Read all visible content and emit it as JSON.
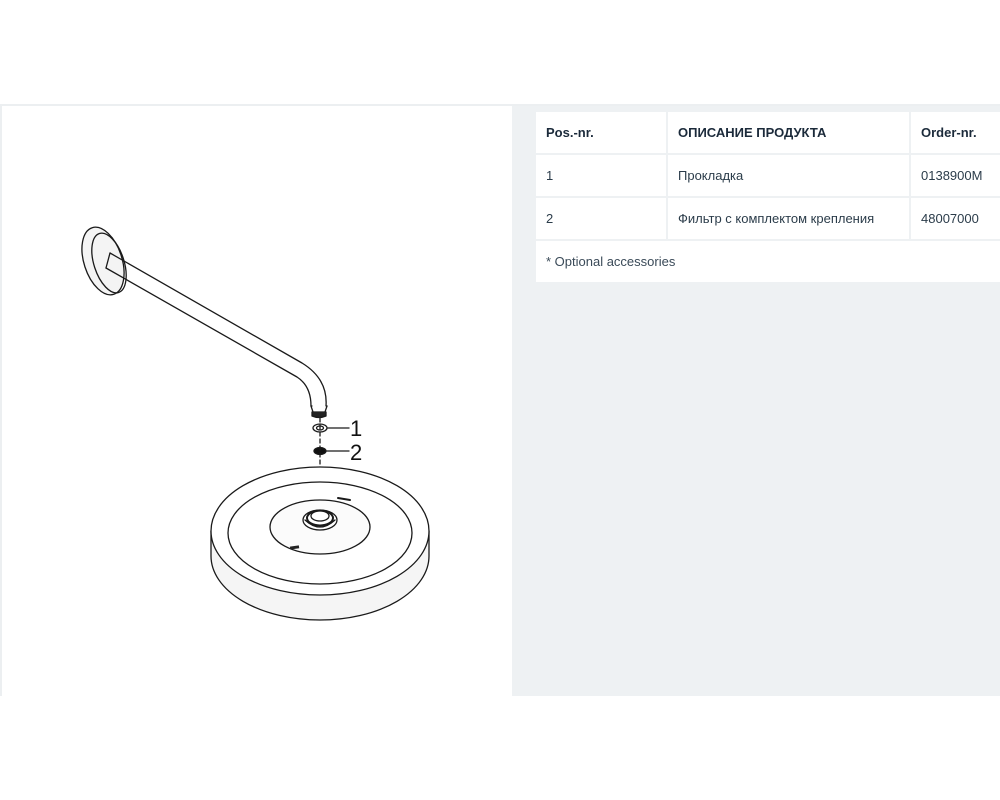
{
  "table": {
    "headers": {
      "pos": "Pos.-nr.",
      "description": "ОПИСАНИЕ ПРОДУКТА",
      "order": "Order-nr."
    },
    "rows": [
      {
        "pos": "1",
        "description": "Прокладка",
        "order": "0138900M"
      },
      {
        "pos": "2",
        "description": "Фильтр с комплектом крепления",
        "order": "48007000"
      }
    ],
    "footnote": "* Optional accessories"
  },
  "drawing": {
    "callouts": [
      "1",
      "2"
    ]
  }
}
